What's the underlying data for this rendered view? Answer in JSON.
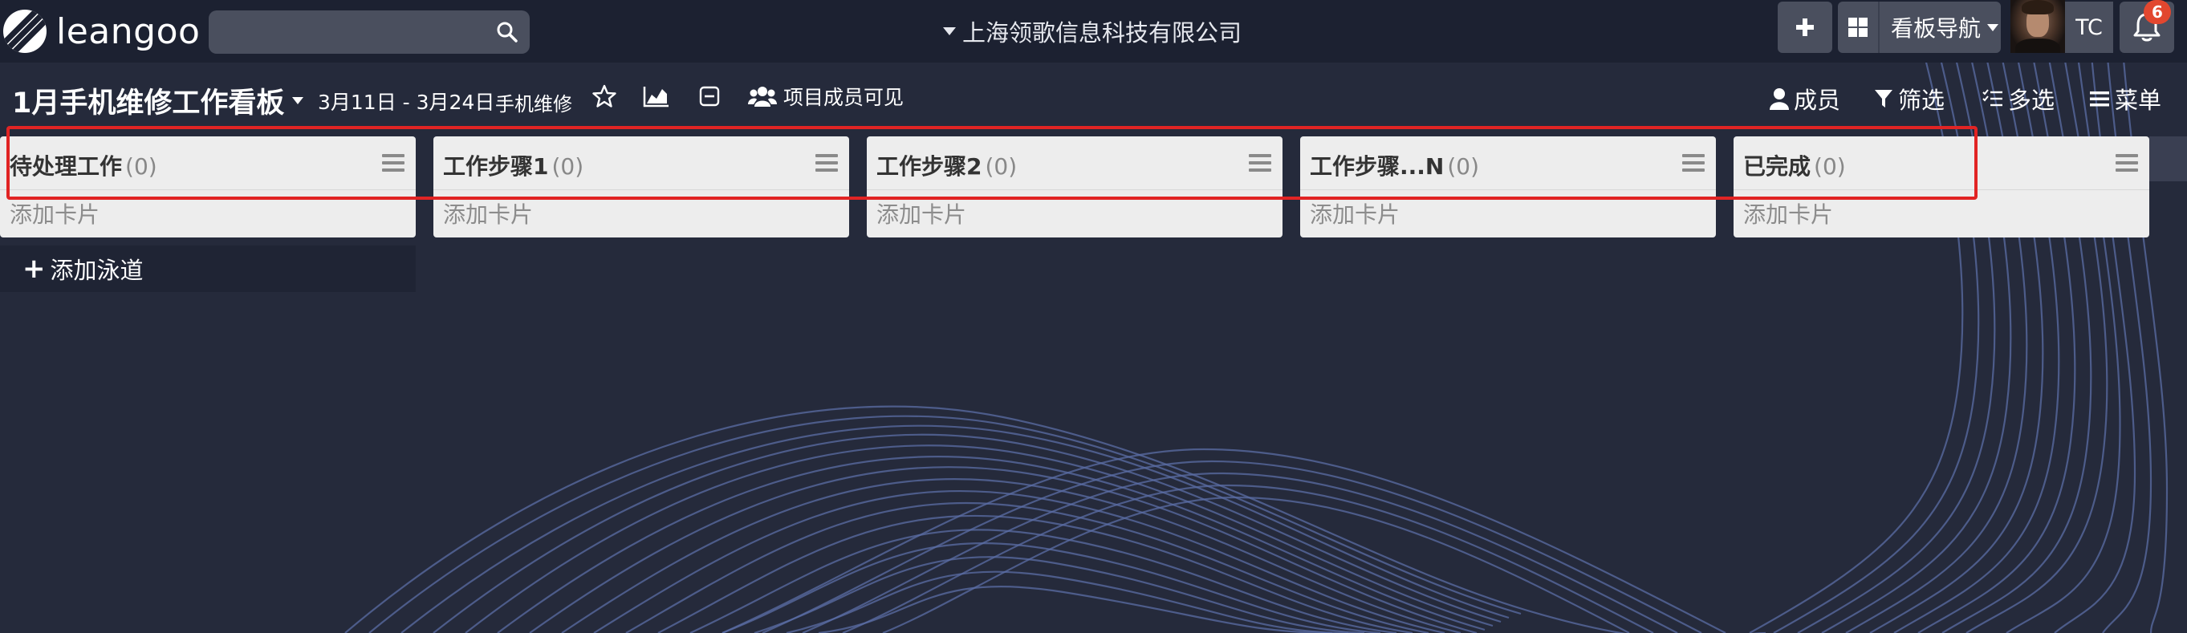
{
  "app": {
    "logo_text": "leangoo",
    "company": "上海领歌信息科技有限公司",
    "search": {
      "placeholder": "",
      "value": ""
    },
    "nav_label": "看板导航",
    "user_initials": "TC",
    "notification_count": "6",
    "icons": {
      "search": "search-icon",
      "plus": "plus-icon",
      "grid": "grid-icon",
      "bell": "bell-icon"
    }
  },
  "board": {
    "title": "1月手机维修工作看板",
    "date_range": "3月11日 - 3月24日",
    "tag": "手机维修",
    "visibility": "项目成员可见",
    "actions": {
      "members": "成员",
      "filter": "筛选",
      "multi": "多选",
      "menu": "菜单"
    }
  },
  "lanes": [
    {
      "title": "待处理工作",
      "count": "(0)",
      "add_card": "添加卡片"
    },
    {
      "title": "工作步骤1",
      "count": "(0)",
      "add_card": "添加卡片"
    },
    {
      "title": "工作步骤2",
      "count": "(0)",
      "add_card": "添加卡片"
    },
    {
      "title": "工作步骤...N",
      "count": "(0)",
      "add_card": "添加卡片"
    },
    {
      "title": "已完成",
      "count": "(0)",
      "add_card": "添加卡片"
    }
  ],
  "add_swimlane": "添加泳道",
  "colors": {
    "background": "#252a3b",
    "topbar": "#1c2131",
    "lane": "#ededed",
    "highlight": "#e12424",
    "badge": "#e2472f",
    "curves": "#5b6ea6"
  }
}
